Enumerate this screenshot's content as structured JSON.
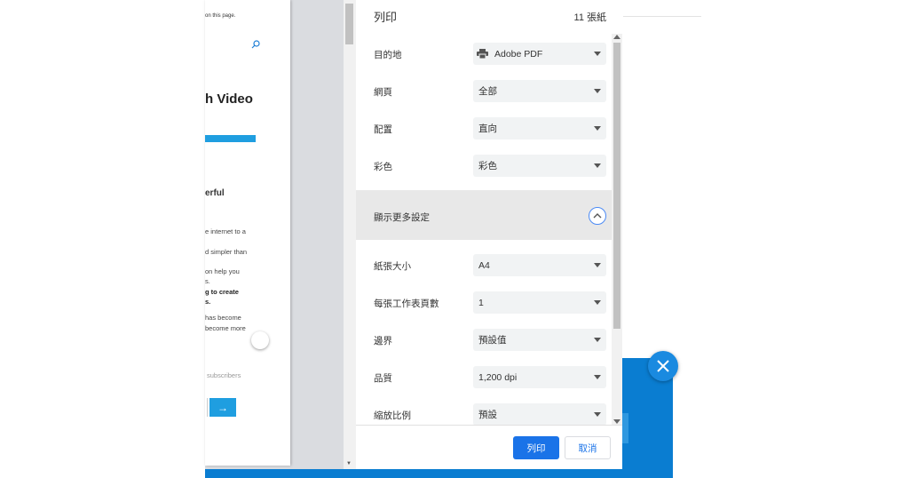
{
  "preview": {
    "note": "on this page.",
    "title": "h Video",
    "subtitle": "erful",
    "lines": [
      "e internet to a",
      "d simpler than",
      "on help you",
      "s.",
      "g to create",
      "s.",
      "has become",
      "become more"
    ],
    "subscribers": "subscribers",
    "arrow": "→"
  },
  "panel": {
    "title": "列印",
    "sheet_count": "11 張紙",
    "rows": [
      {
        "label": "目的地",
        "value": "Adobe PDF"
      },
      {
        "label": "網頁",
        "value": "全部"
      },
      {
        "label": "配置",
        "value": "直向"
      },
      {
        "label": "彩色",
        "value": "彩色"
      }
    ],
    "more_settings": "顯示更多設定",
    "more_rows": [
      {
        "label": "紙張大小",
        "value": "A4"
      },
      {
        "label": "每張工作表頁數",
        "value": "1"
      },
      {
        "label": "邊界",
        "value": "預設值"
      },
      {
        "label": "品質",
        "value": "1,200 dpi"
      },
      {
        "label": "縮放比例",
        "value": "預設"
      }
    ],
    "print_button": "列印",
    "cancel_button": "取消"
  },
  "colors": {
    "accent": "#1a73e8",
    "banner_blue": "#0a7dd1"
  }
}
